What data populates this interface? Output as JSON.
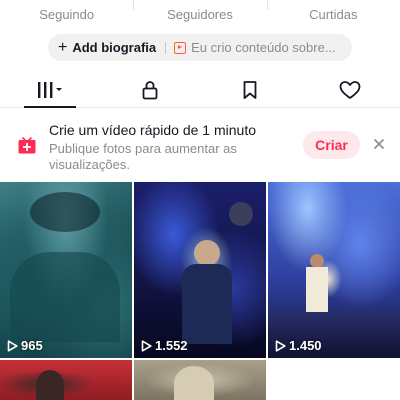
{
  "stats": [
    {
      "label": "Seguindo"
    },
    {
      "label": "Seguidores"
    },
    {
      "label": "Curtidas"
    }
  ],
  "bio": {
    "add_label": "Add biografia",
    "promo_text": "Eu crio conteúdo sobre..."
  },
  "tabs": [
    {
      "icon": "grid-icon",
      "active": true
    },
    {
      "icon": "lock-icon",
      "active": false
    },
    {
      "icon": "bookmark-icon",
      "active": false
    },
    {
      "icon": "heart-icon",
      "active": false
    }
  ],
  "banner": {
    "title": "Crie um vídeo rápido de 1 minuto",
    "subtitle": "Publique fotos para aumentar as visualizações.",
    "create_label": "Criar",
    "close_icon": "close-icon"
  },
  "videos": [
    {
      "views": "965"
    },
    {
      "views": "1.552"
    },
    {
      "views": "1.450"
    },
    {
      "views": ""
    },
    {
      "views": ""
    }
  ],
  "colors": {
    "accent": "#fe2c55",
    "accent_bg": "#fde9ec",
    "text_primary": "#161823",
    "text_secondary": "#8a8b91",
    "pill_bg": "#f1f1f2"
  }
}
